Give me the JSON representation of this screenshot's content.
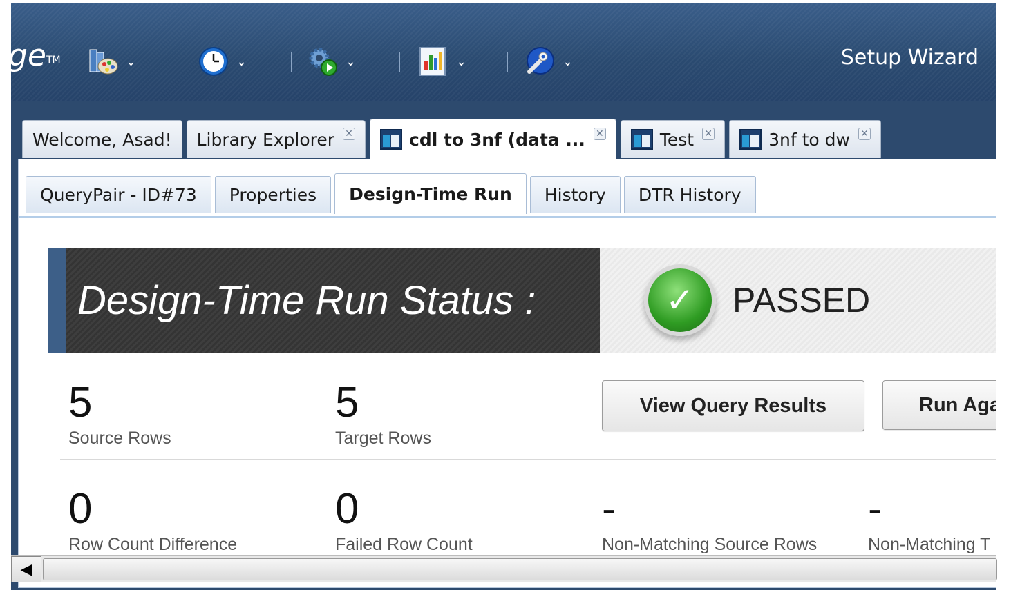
{
  "brand": {
    "text": "ge",
    "tm": "TM"
  },
  "toolbar": {
    "chevron": "⌄",
    "items": [
      {
        "icon": "palette-library-icon"
      },
      {
        "icon": "clock-icon"
      },
      {
        "icon": "gear-run-icon"
      },
      {
        "icon": "report-chart-icon"
      },
      {
        "icon": "wrench-globe-icon"
      }
    ],
    "setup_wizard": "Setup Wizard"
  },
  "outer_tabs": [
    {
      "label": "Welcome, Asad!",
      "closable": false,
      "active": false
    },
    {
      "label": "Library Explorer",
      "closable": true,
      "active": false
    },
    {
      "label": "cdl to 3nf (data ...",
      "closable": true,
      "active": true
    },
    {
      "label": "Test",
      "closable": true,
      "active": false
    },
    {
      "label": "3nf to dw",
      "closable": true,
      "active": false
    }
  ],
  "close_glyph": "✕",
  "inner_tabs": [
    {
      "label": "QueryPair - ID#73"
    },
    {
      "label": "Properties"
    },
    {
      "label": "Design-Time Run"
    },
    {
      "label": "History"
    },
    {
      "label": "DTR History"
    }
  ],
  "status": {
    "title": "Design-Time Run Status :",
    "result": "PASSED",
    "check_glyph": "✓",
    "accent_color": "#2f9c23"
  },
  "metrics": {
    "source_rows": {
      "value": "5",
      "label": "Source Rows"
    },
    "target_rows": {
      "value": "5",
      "label": "Target Rows"
    },
    "row_count_diff": {
      "value": "0",
      "label": "Row Count Difference"
    },
    "failed_row_count": {
      "value": "0",
      "label": "Failed Row Count"
    },
    "non_matching_source": {
      "value": "-",
      "label": "Non-Matching Source Rows"
    },
    "non_matching_target": {
      "value": "-",
      "label": "Non-Matching T"
    }
  },
  "actions": {
    "view_results": "View Query Results",
    "run_again": "Run Aga"
  },
  "scrollbar": {
    "left_arrow": "◀"
  }
}
